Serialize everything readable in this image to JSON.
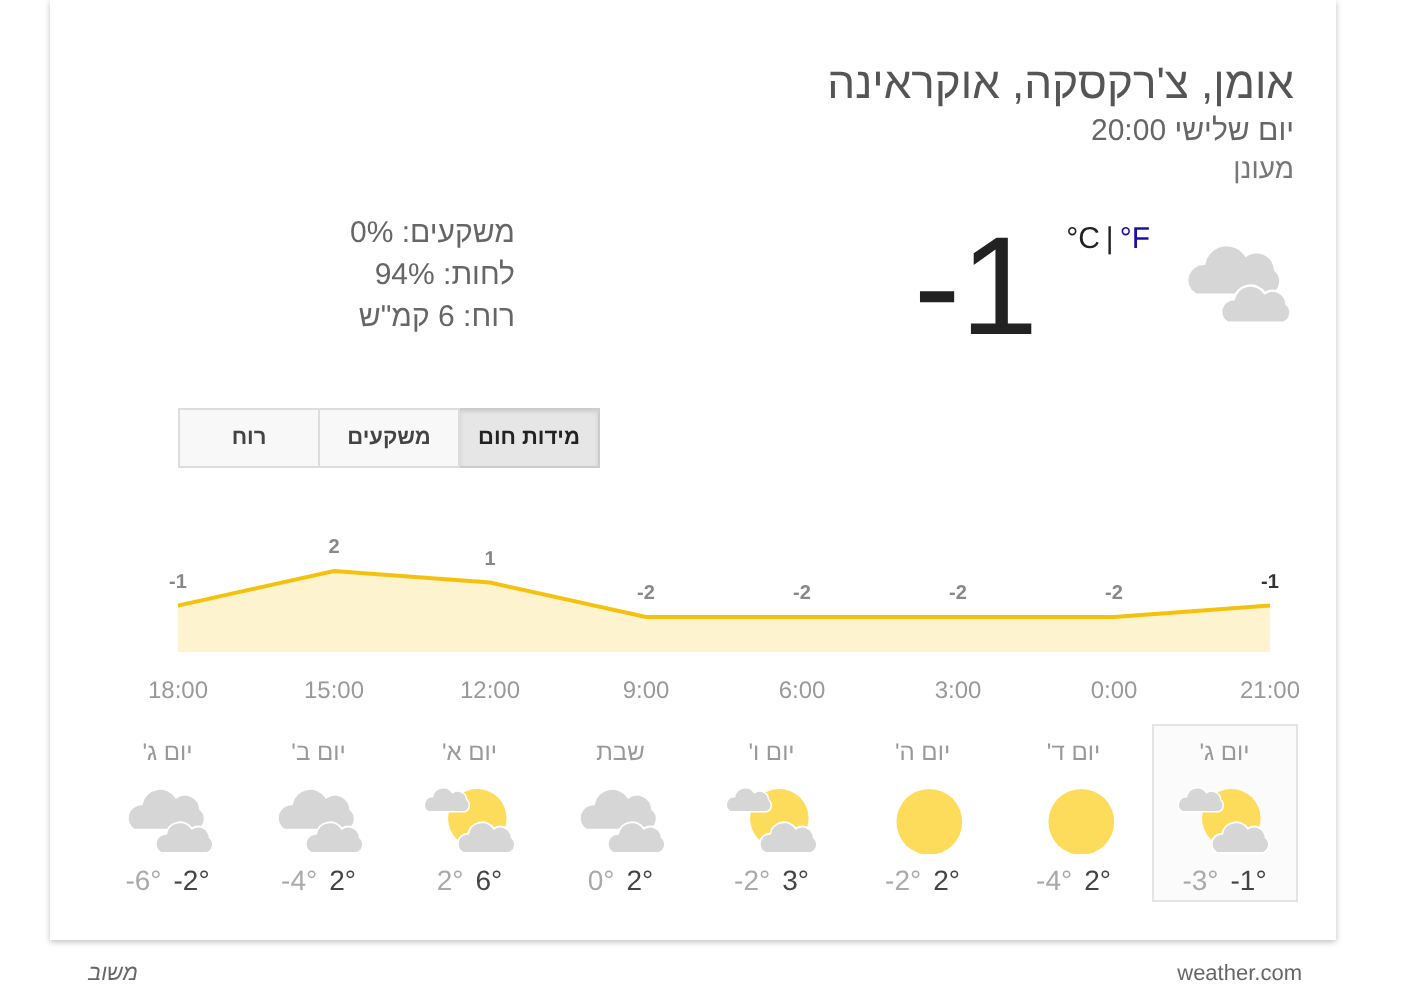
{
  "location": "אומן, צ'רקסקה, אוקראינה",
  "time": "יום שלישי 20:00",
  "condition": "מעונן",
  "current": {
    "temperature": "-1",
    "kind": "cloudy",
    "separator": "|",
    "units": [
      {
        "label": "°F",
        "selected": false
      },
      {
        "label": "°C",
        "selected": true
      }
    ]
  },
  "details": [
    "משקעים: 0%",
    "לחות: 94%",
    "רוח: 6 קמ\"ש"
  ],
  "tabs": [
    {
      "label": "מידות חום",
      "selected": true
    },
    {
      "label": "משקעים",
      "selected": false
    },
    {
      "label": "רוח",
      "selected": false
    }
  ],
  "chart_data": {
    "type": "area",
    "categories": [
      "18:00",
      "15:00",
      "12:00",
      "9:00",
      "6:00",
      "3:00",
      "0:00",
      "21:00"
    ],
    "data_labels": true,
    "series": [
      {
        "color": "#f4c20d",
        "values": [
          -1,
          2,
          1,
          -2,
          -2,
          -2,
          -2,
          -1
        ]
      }
    ]
  },
  "days": [
    {
      "day": "יום ג'",
      "kind": "partly",
      "high": "-1°",
      "low": "-3°",
      "selected": true
    },
    {
      "day": "יום ד'",
      "kind": "sunny",
      "high": "2°",
      "low": "-4°",
      "selected": false
    },
    {
      "day": "יום ה'",
      "kind": "sunny",
      "high": "2°",
      "low": "-2°",
      "selected": false
    },
    {
      "day": "יום ו'",
      "kind": "partly",
      "high": "3°",
      "low": "-2°",
      "selected": false
    },
    {
      "day": "שבת",
      "kind": "cloudy",
      "high": "2°",
      "low": "0°",
      "selected": false
    },
    {
      "day": "יום א'",
      "kind": "partly",
      "high": "6°",
      "low": "2°",
      "selected": false
    },
    {
      "day": "יום ב'",
      "kind": "cloudy",
      "high": "2°",
      "low": "-4°",
      "selected": false
    },
    {
      "day": "יום ג'",
      "kind": "cloudy",
      "high": "-2°",
      "low": "-6°",
      "selected": false
    }
  ],
  "footer": {
    "source": "weather.com",
    "feedback": "משוב"
  }
}
